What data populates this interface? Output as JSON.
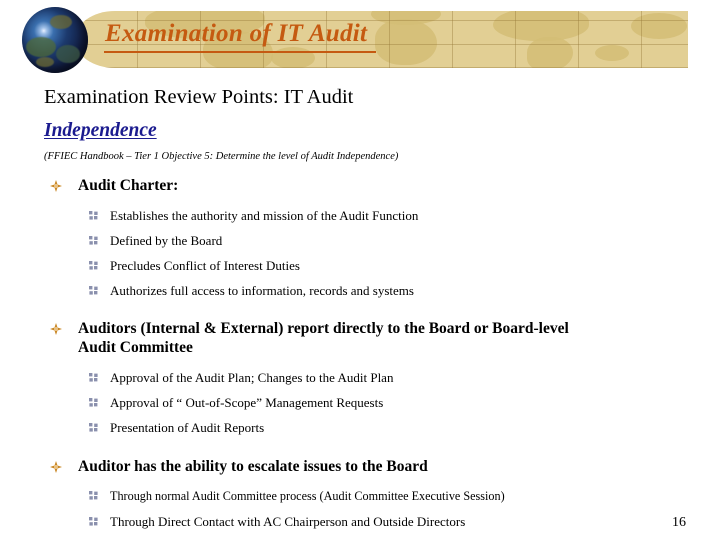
{
  "header": {
    "banner_title": "Examination of IT Audit",
    "globe_icon": "globe-icon",
    "banner_bg_color": "#e2cf94",
    "title_color": "#c55a11"
  },
  "body": {
    "heading_main": "Examination Review Points:  IT Audit",
    "heading_sub": "Independence",
    "heading_sub_color": "#1b1b8f",
    "source_note": "(FFIEC Handbook – Tier 1 Objective 5: Determine the level of Audit Independence)",
    "bullet_marker_level1": "orange-star-bullet-icon",
    "bullet_marker_level2": "gray-squares-bullet-icon",
    "bullet_marker_level1_color": "#c8841f",
    "bullet_marker_level2_color": "#8a90ad",
    "groups": [
      {
        "heading": "Audit Charter:",
        "items": [
          "Establishes the authority and mission of the Audit Function",
          "Defined by the Board",
          "Precludes Conflict of Interest Duties",
          "Authorizes full access to information, records and systems"
        ]
      },
      {
        "heading": "Auditors (Internal & External) report directly to the Board or Board-level Audit Committee",
        "items": [
          "Approval of the Audit Plan; Changes to the Audit Plan",
          "Approval of “ Out-of-Scope” Management Requests",
          "Presentation of Audit Reports"
        ]
      },
      {
        "heading": "Auditor has the ability to escalate issues to the Board",
        "items": [
          "Through normal Audit Committee process (Audit Committee Executive Session)",
          "Through Direct Contact with AC Chairperson and Outside Directors"
        ]
      }
    ]
  },
  "footer": {
    "page_number": "16"
  }
}
